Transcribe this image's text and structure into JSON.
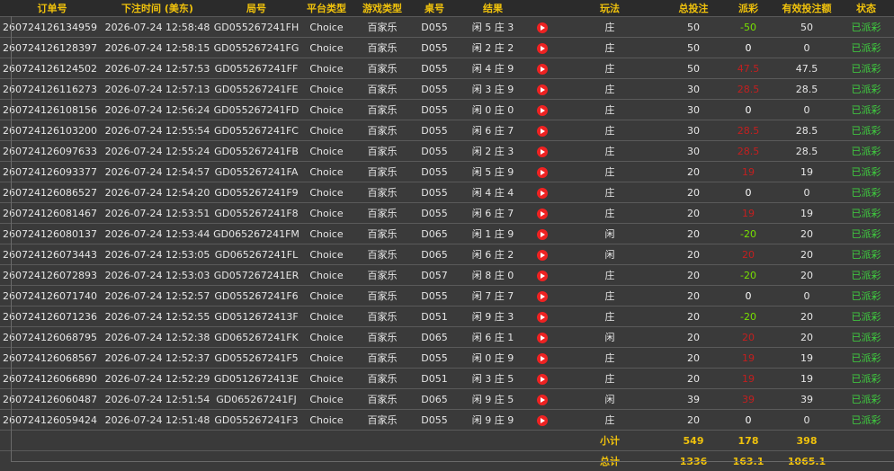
{
  "headers": {
    "order_id": "订单号",
    "bet_time": "下注时间 (美东)",
    "round_id": "局号",
    "platform": "平台类型",
    "game_type": "游戏类型",
    "table_no": "桌号",
    "result": "结果",
    "play": "玩法",
    "total_bet": "总投注",
    "payout": "派彩",
    "valid_bet": "有效投注额",
    "status": "状态"
  },
  "rows": [
    {
      "order_id": "260724126134959",
      "bet_time": "2026-07-24 12:58:48",
      "round_id": "GD055267241FH",
      "platform": "Choice",
      "game_type": "百家乐",
      "table_no": "D055",
      "result": "闲 5 庄 3",
      "play": "庄",
      "total_bet": "50",
      "payout": "-50",
      "payout_color": "#77e000",
      "valid_bet": "50",
      "status": "已派彩"
    },
    {
      "order_id": "260724126128397",
      "bet_time": "2026-07-24 12:58:15",
      "round_id": "GD055267241FG",
      "platform": "Choice",
      "game_type": "百家乐",
      "table_no": "D055",
      "result": "闲 2 庄 2",
      "play": "庄",
      "total_bet": "50",
      "payout": "0",
      "payout_color": "#ffffff",
      "valid_bet": "0",
      "status": "已派彩"
    },
    {
      "order_id": "260724126124502",
      "bet_time": "2026-07-24 12:57:53",
      "round_id": "GD055267241FF",
      "platform": "Choice",
      "game_type": "百家乐",
      "table_no": "D055",
      "result": "闲 4 庄 9",
      "play": "庄",
      "total_bet": "50",
      "payout": "47.5",
      "payout_color": "#c41f1f",
      "valid_bet": "47.5",
      "status": "已派彩"
    },
    {
      "order_id": "260724126116273",
      "bet_time": "2026-07-24 12:57:13",
      "round_id": "GD055267241FE",
      "platform": "Choice",
      "game_type": "百家乐",
      "table_no": "D055",
      "result": "闲 3 庄 9",
      "play": "庄",
      "total_bet": "30",
      "payout": "28.5",
      "payout_color": "#c41f1f",
      "valid_bet": "28.5",
      "status": "已派彩"
    },
    {
      "order_id": "260724126108156",
      "bet_time": "2026-07-24 12:56:24",
      "round_id": "GD055267241FD",
      "platform": "Choice",
      "game_type": "百家乐",
      "table_no": "D055",
      "result": "闲 0 庄 0",
      "play": "庄",
      "total_bet": "30",
      "payout": "0",
      "payout_color": "#ffffff",
      "valid_bet": "0",
      "status": "已派彩"
    },
    {
      "order_id": "260724126103200",
      "bet_time": "2026-07-24 12:55:54",
      "round_id": "GD055267241FC",
      "platform": "Choice",
      "game_type": "百家乐",
      "table_no": "D055",
      "result": "闲 6 庄 7",
      "play": "庄",
      "total_bet": "30",
      "payout": "28.5",
      "payout_color": "#c41f1f",
      "valid_bet": "28.5",
      "status": "已派彩"
    },
    {
      "order_id": "260724126097633",
      "bet_time": "2026-07-24 12:55:24",
      "round_id": "GD055267241FB",
      "platform": "Choice",
      "game_type": "百家乐",
      "table_no": "D055",
      "result": "闲 2 庄 3",
      "play": "庄",
      "total_bet": "30",
      "payout": "28.5",
      "payout_color": "#c41f1f",
      "valid_bet": "28.5",
      "status": "已派彩"
    },
    {
      "order_id": "260724126093377",
      "bet_time": "2026-07-24 12:54:57",
      "round_id": "GD055267241FA",
      "platform": "Choice",
      "game_type": "百家乐",
      "table_no": "D055",
      "result": "闲 5 庄 9",
      "play": "庄",
      "total_bet": "20",
      "payout": "19",
      "payout_color": "#c41f1f",
      "valid_bet": "19",
      "status": "已派彩"
    },
    {
      "order_id": "260724126086527",
      "bet_time": "2026-07-24 12:54:20",
      "round_id": "GD055267241F9",
      "platform": "Choice",
      "game_type": "百家乐",
      "table_no": "D055",
      "result": "闲 4 庄 4",
      "play": "庄",
      "total_bet": "20",
      "payout": "0",
      "payout_color": "#ffffff",
      "valid_bet": "0",
      "status": "已派彩"
    },
    {
      "order_id": "260724126081467",
      "bet_time": "2026-07-24 12:53:51",
      "round_id": "GD055267241F8",
      "platform": "Choice",
      "game_type": "百家乐",
      "table_no": "D055",
      "result": "闲 6 庄 7",
      "play": "庄",
      "total_bet": "20",
      "payout": "19",
      "payout_color": "#c41f1f",
      "valid_bet": "19",
      "status": "已派彩"
    },
    {
      "order_id": "260724126080137",
      "bet_time": "2026-07-24 12:53:44",
      "round_id": "GD065267241FM",
      "platform": "Choice",
      "game_type": "百家乐",
      "table_no": "D065",
      "result": "闲 1 庄 9",
      "play": "闲",
      "total_bet": "20",
      "payout": "-20",
      "payout_color": "#77e000",
      "valid_bet": "20",
      "status": "已派彩"
    },
    {
      "order_id": "260724126073443",
      "bet_time": "2026-07-24 12:53:05",
      "round_id": "GD065267241FL",
      "platform": "Choice",
      "game_type": "百家乐",
      "table_no": "D065",
      "result": "闲 6 庄 2",
      "play": "闲",
      "total_bet": "20",
      "payout": "20",
      "payout_color": "#c41f1f",
      "valid_bet": "20",
      "status": "已派彩"
    },
    {
      "order_id": "260724126072893",
      "bet_time": "2026-07-24 12:53:03",
      "round_id": "GD057267241ER",
      "platform": "Choice",
      "game_type": "百家乐",
      "table_no": "D057",
      "result": "闲 8 庄 0",
      "play": "庄",
      "total_bet": "20",
      "payout": "-20",
      "payout_color": "#77e000",
      "valid_bet": "20",
      "status": "已派彩"
    },
    {
      "order_id": "260724126071740",
      "bet_time": "2026-07-24 12:52:57",
      "round_id": "GD055267241F6",
      "platform": "Choice",
      "game_type": "百家乐",
      "table_no": "D055",
      "result": "闲 7 庄 7",
      "play": "庄",
      "total_bet": "20",
      "payout": "0",
      "payout_color": "#ffffff",
      "valid_bet": "0",
      "status": "已派彩"
    },
    {
      "order_id": "260724126071236",
      "bet_time": "2026-07-24 12:52:55",
      "round_id": "GD0512672413F",
      "platform": "Choice",
      "game_type": "百家乐",
      "table_no": "D051",
      "result": "闲 9 庄 3",
      "play": "庄",
      "total_bet": "20",
      "payout": "-20",
      "payout_color": "#77e000",
      "valid_bet": "20",
      "status": "已派彩"
    },
    {
      "order_id": "260724126068795",
      "bet_time": "2026-07-24 12:52:38",
      "round_id": "GD065267241FK",
      "platform": "Choice",
      "game_type": "百家乐",
      "table_no": "D065",
      "result": "闲 6 庄 1",
      "play": "闲",
      "total_bet": "20",
      "payout": "20",
      "payout_color": "#c41f1f",
      "valid_bet": "20",
      "status": "已派彩"
    },
    {
      "order_id": "260724126068567",
      "bet_time": "2026-07-24 12:52:37",
      "round_id": "GD055267241F5",
      "platform": "Choice",
      "game_type": "百家乐",
      "table_no": "D055",
      "result": "闲 0 庄 9",
      "play": "庄",
      "total_bet": "20",
      "payout": "19",
      "payout_color": "#c41f1f",
      "valid_bet": "19",
      "status": "已派彩"
    },
    {
      "order_id": "260724126066890",
      "bet_time": "2026-07-24 12:52:29",
      "round_id": "GD0512672413E",
      "platform": "Choice",
      "game_type": "百家乐",
      "table_no": "D051",
      "result": "闲 3 庄 5",
      "play": "庄",
      "total_bet": "20",
      "payout": "19",
      "payout_color": "#c41f1f",
      "valid_bet": "19",
      "status": "已派彩"
    },
    {
      "order_id": "260724126060487",
      "bet_time": "2026-07-24 12:51:54",
      "round_id": "GD065267241FJ",
      "platform": "Choice",
      "game_type": "百家乐",
      "table_no": "D065",
      "result": "闲 9 庄 5",
      "play": "闲",
      "total_bet": "39",
      "payout": "39",
      "payout_color": "#c41f1f",
      "valid_bet": "39",
      "status": "已派彩"
    },
    {
      "order_id": "260724126059424",
      "bet_time": "2026-07-24 12:51:48",
      "round_id": "GD055267241F3",
      "platform": "Choice",
      "game_type": "百家乐",
      "table_no": "D055",
      "result": "闲 9 庄 9",
      "play": "庄",
      "total_bet": "20",
      "payout": "0",
      "payout_color": "#ffffff",
      "valid_bet": "0",
      "status": "已派彩"
    }
  ],
  "subtotal": {
    "label": "小计",
    "total_bet": "549",
    "payout": "178",
    "valid_bet": "398"
  },
  "grandtotal": {
    "label": "总计",
    "total_bet": "1336",
    "payout": "163.1",
    "valid_bet": "1065.1"
  },
  "colors": {
    "header": "#f0c20c",
    "positive": "#77e000",
    "negative": "#c41f1f",
    "status": "#3fcf3f",
    "video_icon": "#e22222"
  },
  "icons": {
    "result_video": "play-video-icon"
  }
}
